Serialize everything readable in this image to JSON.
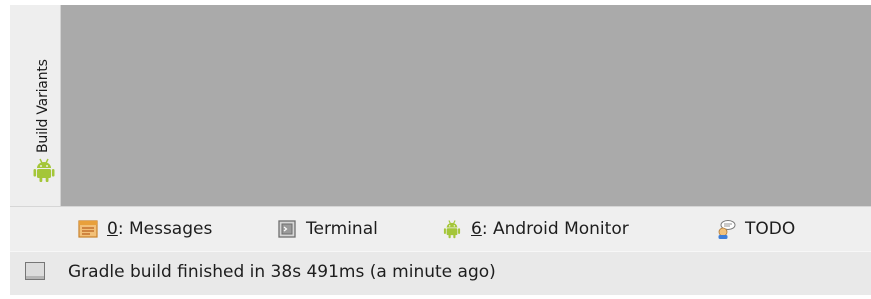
{
  "side_panel": {
    "tab_label": "Build Variants",
    "icon": "android-icon"
  },
  "tool_windows": [
    {
      "number": "0",
      "label": ": Messages",
      "icon": "messages-icon"
    },
    {
      "label": "Terminal",
      "icon": "terminal-icon"
    },
    {
      "number": "6",
      "label": ": Android Monitor",
      "icon": "android-icon"
    },
    {
      "label": "TODO",
      "icon": "todo-icon"
    }
  ],
  "status_bar": {
    "message": "Gradle build finished in 38s 491ms (a minute ago)",
    "toggle_icon": "tool-window-toggle-icon"
  },
  "colors": {
    "content_background": "#aaaaaa",
    "android_green": "#a4c639",
    "messages_orange": "#e8a03b"
  }
}
